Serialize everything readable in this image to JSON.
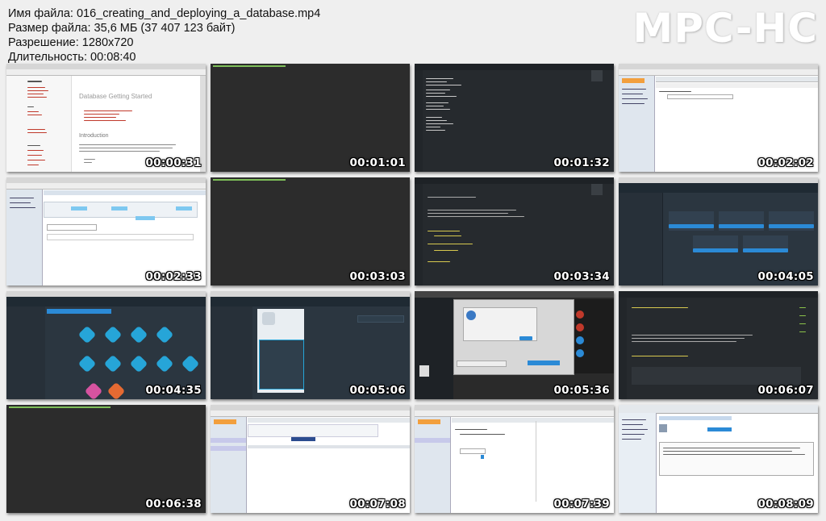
{
  "info": {
    "filename_line": "Имя файла: 016_creating_and_deploying_a_database.mp4",
    "size_line": "Размер файла: 35,6 МБ (37 407 123 байт)",
    "resolution_line": "Разрешение: 1280x720",
    "duration_line": "Длительность: 00:08:40"
  },
  "logo": "MPC-HC",
  "thumbnails": [
    {
      "time": "00:00:31",
      "scene": "browser-document",
      "page_title": "Database Getting Started",
      "page_heading": "Introduction"
    },
    {
      "time": "00:01:01",
      "scene": "terminal"
    },
    {
      "time": "00:01:32",
      "scene": "code-editor-list"
    },
    {
      "time": "00:02:02",
      "scene": "phpmyadmin"
    },
    {
      "time": "00:02:33",
      "scene": "phpmyadmin-table"
    },
    {
      "time": "00:03:03",
      "scene": "terminal-empty"
    },
    {
      "time": "00:03:34",
      "scene": "code-editor"
    },
    {
      "time": "00:04:05",
      "scene": "cloud-dashboard-cards"
    },
    {
      "time": "00:04:35",
      "scene": "cloud-catalog"
    },
    {
      "time": "00:05:06",
      "scene": "cloud-service-detail"
    },
    {
      "time": "00:05:36",
      "scene": "mac-dialog"
    },
    {
      "time": "00:06:07",
      "scene": "code-editor-php"
    },
    {
      "time": "00:06:38",
      "scene": "terminal-command"
    },
    {
      "time": "00:07:08",
      "scene": "phpmyadmin-form"
    },
    {
      "time": "00:07:39",
      "scene": "phpmyadmin-settings"
    },
    {
      "time": "00:08:09",
      "scene": "phpmyadmin-sql"
    }
  ],
  "colors": {
    "background": "#efefef",
    "logo": "#ffffff",
    "terminal": "#2c2c2c",
    "editor": "#262a2e",
    "cloud_dark": "#2b3640",
    "cloud_accent": "#26a5d8"
  }
}
